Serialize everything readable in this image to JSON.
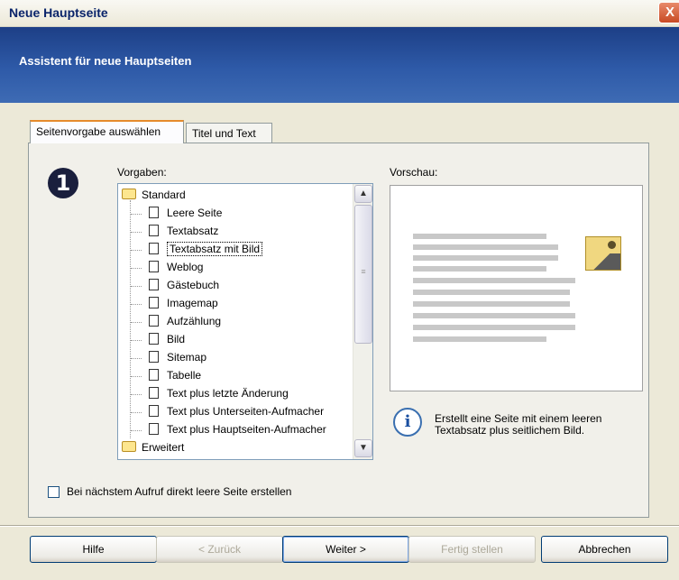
{
  "window": {
    "title": "Neue Hauptseite",
    "close_label": "X"
  },
  "banner": {
    "title": "Assistent für neue Hauptseiten"
  },
  "tabs": [
    {
      "label": "Seitenvorgabe auswählen",
      "active": true
    },
    {
      "label": "Titel und Text",
      "active": false
    }
  ],
  "step": {
    "number": "1"
  },
  "vorgaben": {
    "label": "Vorgaben:",
    "folders": [
      {
        "name": "Standard",
        "items": [
          "Leere Seite",
          "Textabsatz",
          "Textabsatz mit Bild",
          "Weblog",
          "Gästebuch",
          "Imagemap",
          "Aufzählung",
          "Bild",
          "Sitemap",
          "Tabelle",
          "Text plus letzte Änderung",
          "Text plus Unterseiten-Aufmacher",
          "Text plus Hauptseiten-Aufmacher"
        ],
        "selected_index": 2
      },
      {
        "name": "Erweitert",
        "items": []
      }
    ]
  },
  "preview": {
    "label": "Vorschau:"
  },
  "info": {
    "text_line1": "Erstellt eine Seite mit einem leeren",
    "text_line2": "Textabsatz plus seitlichem Bild."
  },
  "checkbox": {
    "label": "Bei nächstem Aufruf direkt leere Seite erstellen",
    "checked": false
  },
  "buttons": {
    "help": "Hilfe",
    "back": "< Zurück",
    "next": "Weiter >",
    "finish": "Fertig stellen",
    "cancel": "Abbrechen"
  },
  "colors": {
    "banner": "#2e5aa8",
    "accent_tab": "#e68b2c",
    "close": "#c84a24"
  }
}
